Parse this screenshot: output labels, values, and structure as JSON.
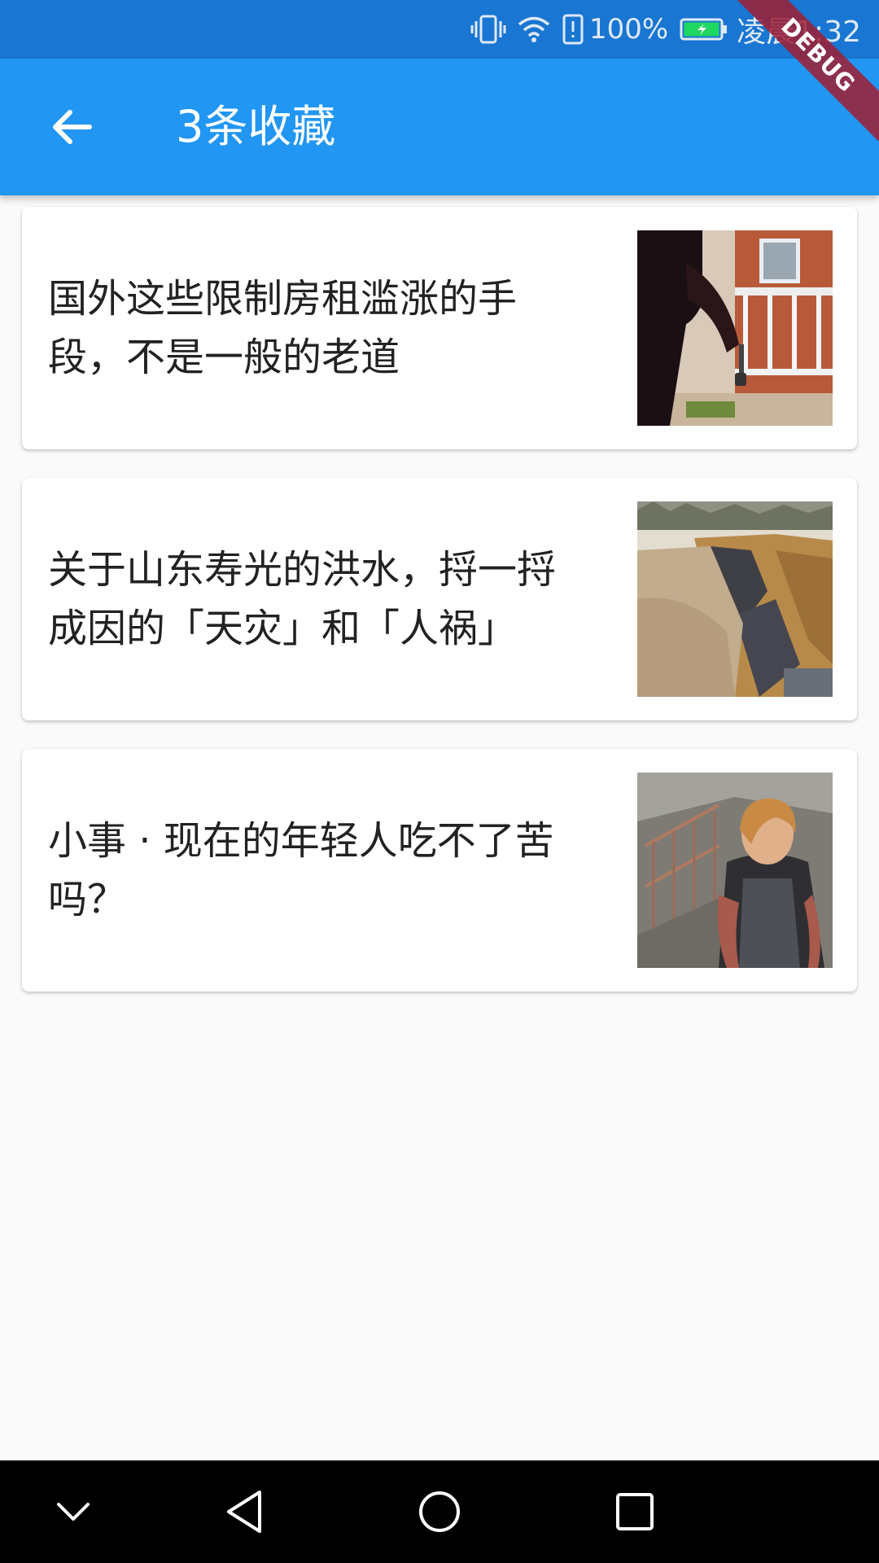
{
  "status_bar": {
    "battery_pct": "100%",
    "time": "凌晨1:32",
    "icons": [
      "vibrate-icon",
      "wifi-icon",
      "battery-alert-icon",
      "battery-charging-icon"
    ]
  },
  "app_bar": {
    "title": "3条收藏",
    "back_icon": "arrow-back-icon",
    "color": "#2196f3"
  },
  "debug_banner": "DEBUG",
  "favorites": [
    {
      "title": "国外这些限制房租滥涨的手段，不是一般的老道",
      "thumb": "person-holding-keys-image"
    },
    {
      "title": "关于山东寿光的洪水，捋一捋成因的「天灾」和「人祸」",
      "thumb": "collapsed-road-flood-image"
    },
    {
      "title": "小事 · 现在的年轻人吃不了苦吗？",
      "thumb": "young-worker-apron-image"
    }
  ],
  "nav_bar": {
    "icons": [
      "chevron-down-icon",
      "back-triangle-icon",
      "home-circle-icon",
      "recents-square-icon"
    ]
  }
}
